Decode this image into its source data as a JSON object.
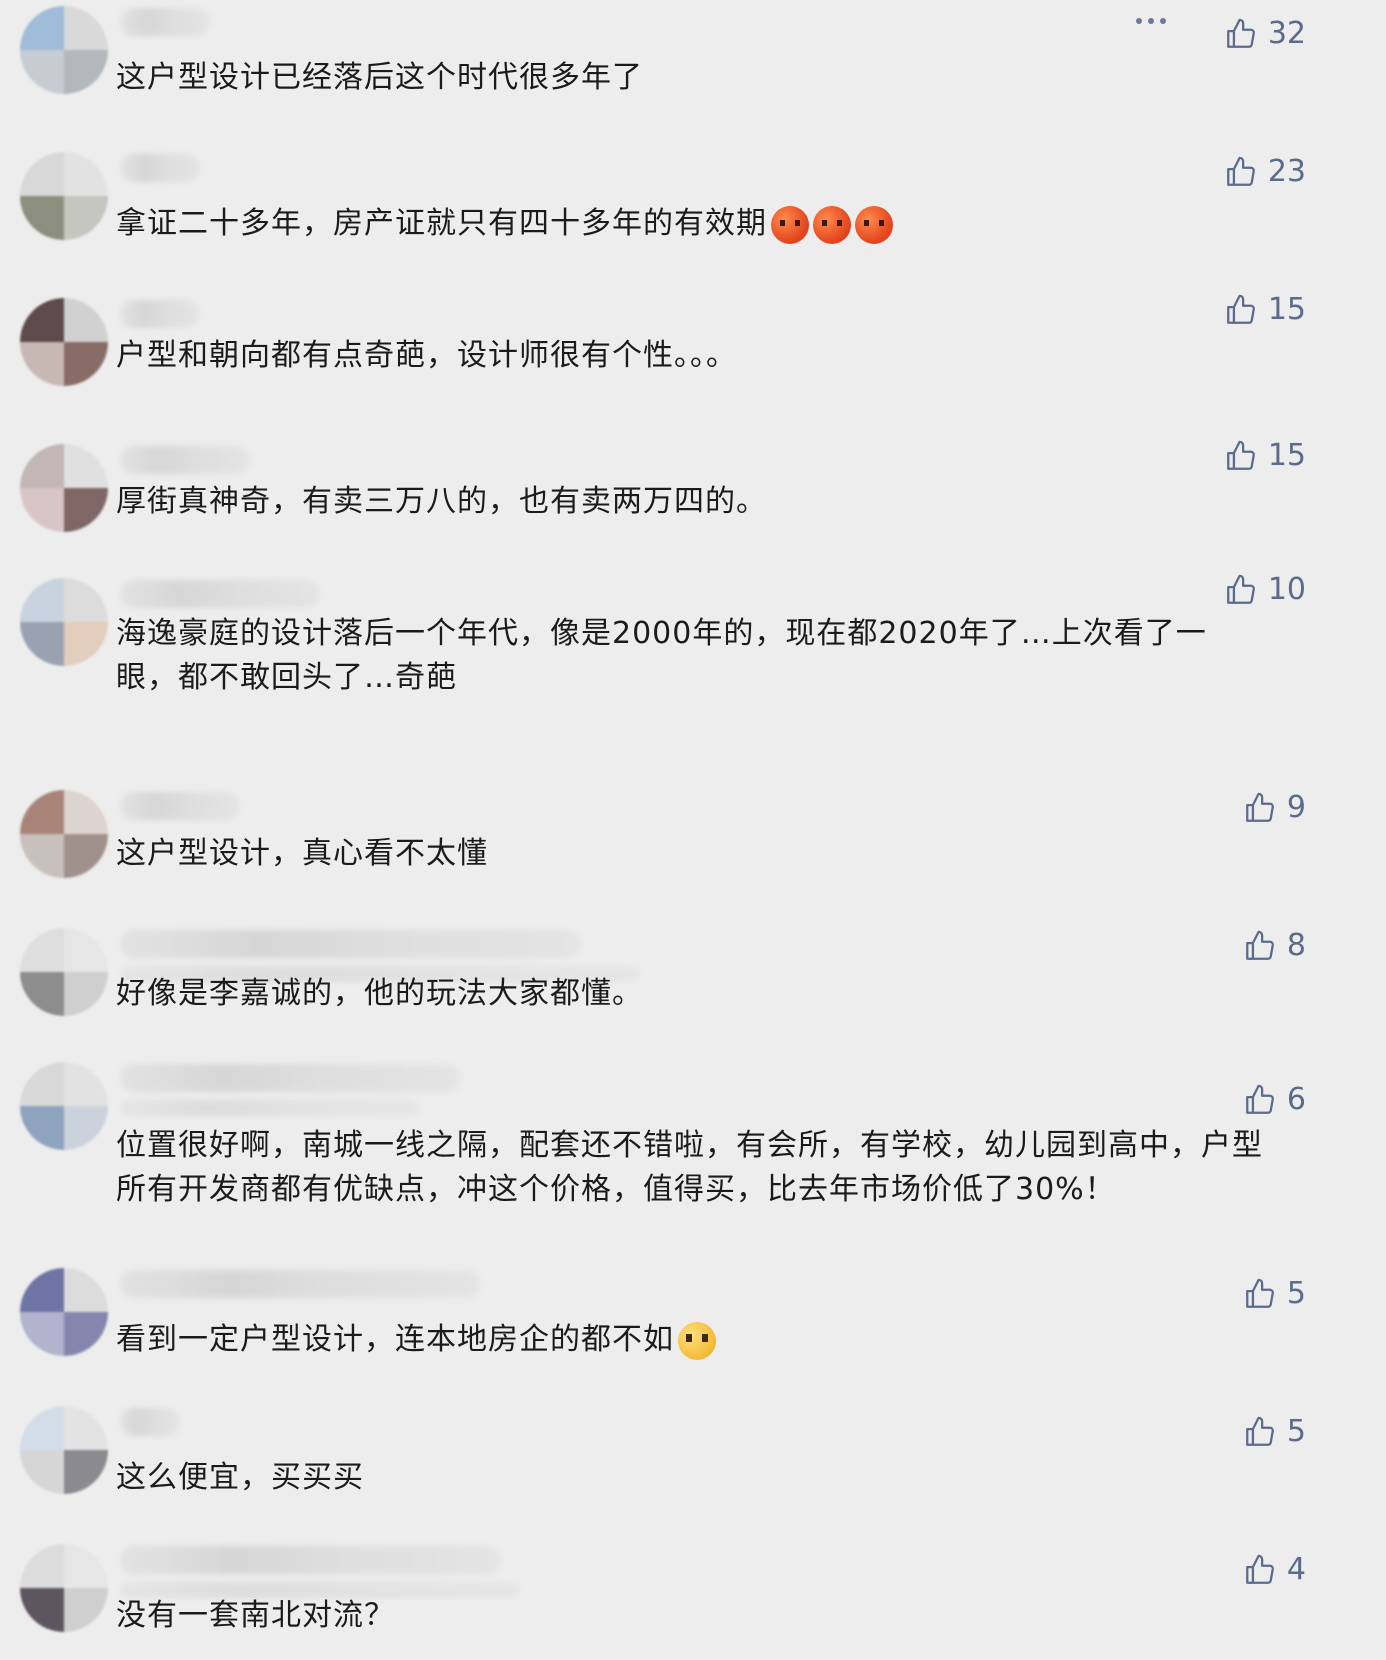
{
  "colors": {
    "background": "#ededed",
    "text": "#1b1b1b",
    "like": "#5a6b8c"
  },
  "icons": {
    "like": "thumbs-up-outline-icon",
    "more": "more-horizontal-icon"
  },
  "comments": [
    {
      "text": "这户型设计已经落后这个时代很多年了",
      "likes": "32"
    },
    {
      "text": "拿证二十多年，房产证就只有四十多年的有效期",
      "likes": "23",
      "emoji": "angry-face-icon"
    },
    {
      "text": "户型和朝向都有点奇葩，设计师很有个性。。。",
      "likes": "15"
    },
    {
      "text": "厚街真神奇，有卖三万八的，也有卖两万四的。",
      "likes": "15"
    },
    {
      "text": "海逸豪庭的设计落后一个年代，像是2000年的，现在都2020年了…上次看了一眼，都不敢回头了…奇葩",
      "likes": "10"
    },
    {
      "text": "这户型设计，真心看不太懂",
      "likes": "9"
    },
    {
      "text": "好像是李嘉诚的，他的玩法大家都懂。",
      "likes": "8"
    },
    {
      "text": "位置很好啊，南城一线之隔，配套还不错啦，有会所，有学校，幼儿园到高中，户型所有开发商都有优缺点，冲这个价格，值得买，比去年市场价低了30%！",
      "likes": "6"
    },
    {
      "text": "看到一定户型设计，连本地房企的都不如",
      "likes": "5",
      "emoji": "pleading-face-icon"
    },
    {
      "text": "这么便宜，买买买",
      "likes": "5"
    },
    {
      "text": "没有一套南北对流？",
      "likes": "4"
    }
  ]
}
